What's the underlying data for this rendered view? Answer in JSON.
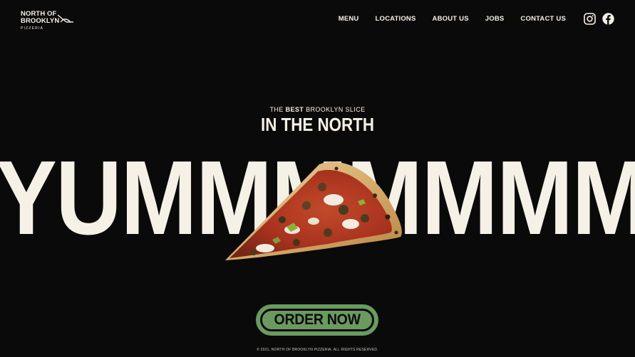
{
  "brand": {
    "line1": "NORTH OF",
    "line2": "BROOKLYN",
    "sub": "PIZZERIA"
  },
  "nav": {
    "items": [
      {
        "label": "MENU"
      },
      {
        "label": "LOCATIONS"
      },
      {
        "label": "ABOUT US"
      },
      {
        "label": "JOBS"
      },
      {
        "label": "CONTACT US"
      }
    ]
  },
  "social": {
    "icons": [
      "instagram-icon",
      "facebook-icon"
    ]
  },
  "hero": {
    "tagline_pre": "THE ",
    "tagline_bold": "BEST",
    "tagline_post": " BROOKLYN SLICE",
    "headline": "IN THE NORTH",
    "big_word": "YUMMMMMMMMMM"
  },
  "cta": {
    "label": "ORDER NOW"
  },
  "footer": {
    "text": "© 2021, NORTH OF BROOKLYN PIZZERIA. ALL RIGHTS RESERVED."
  },
  "colors": {
    "background": "#0a0a0a",
    "cream": "#f6f1e7",
    "accent_green": "#6b9a60"
  }
}
